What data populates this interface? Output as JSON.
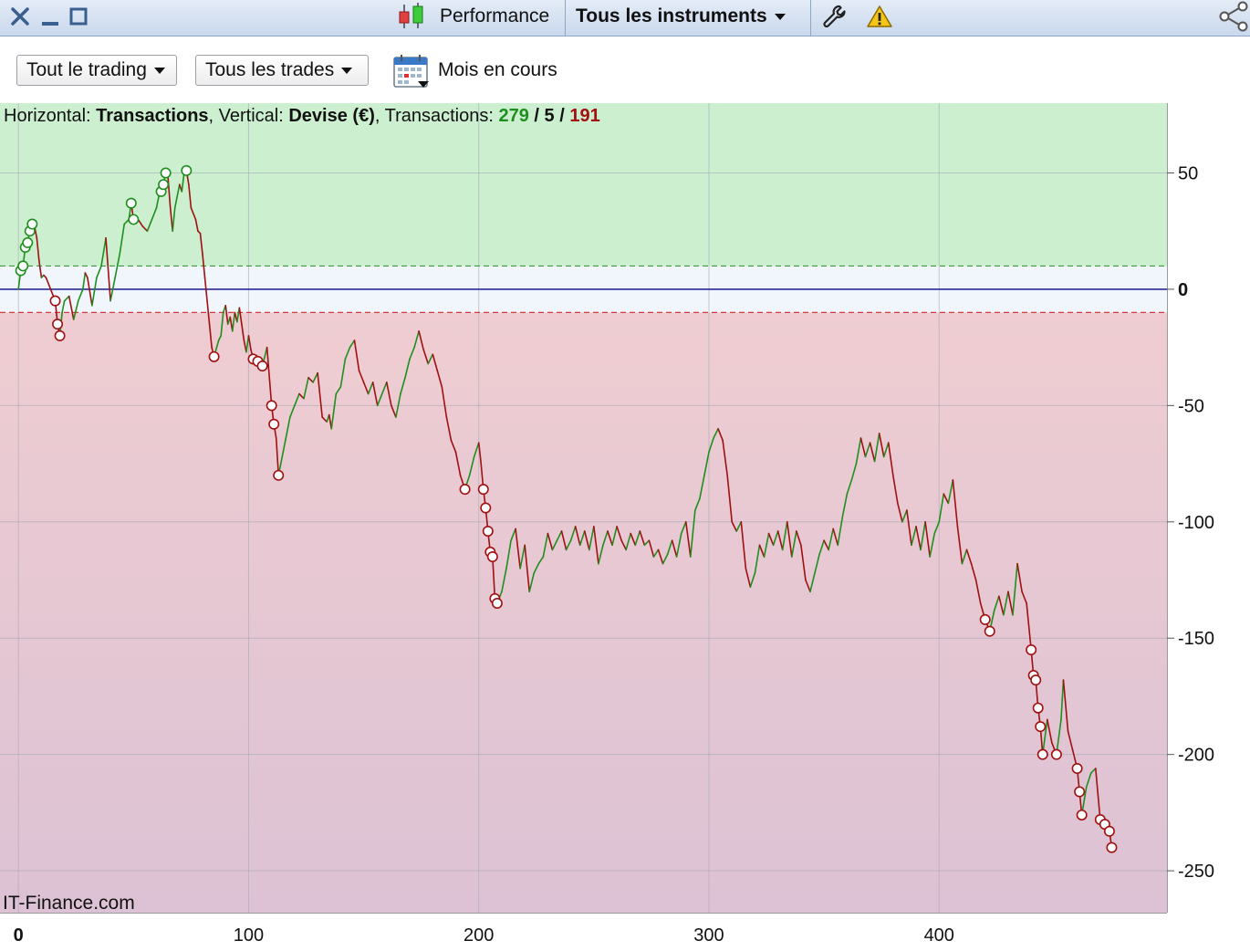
{
  "titlebar": {
    "performance_tab": "Performance",
    "instruments_menu": "Tous les instruments"
  },
  "toolbar": {
    "trading_filter": "Tout le trading",
    "trades_filter": "Tous les trades",
    "period_label": "Mois en cours"
  },
  "chart_header": {
    "h_label": "Horizontal: ",
    "h_value": "Transactions",
    "v_label": ", Vertical: ",
    "v_value": "Devise (€)",
    "t_label": ", Transactions: ",
    "winners": "279",
    "sep1": " / ",
    "neutral": "5",
    "sep2": " / ",
    "losers": "191"
  },
  "watermark": "IT-Finance.com",
  "colors": {
    "profit_zone": "#ccefd0",
    "loss_zone_top": "#efcdd2",
    "loss_zone_bottom": "#dcc2d4",
    "neutral_band": "#f1f5fc",
    "up_line": "#1e8f1e",
    "down_line": "#a01010",
    "zero_line": "#2a2a9a"
  },
  "chart_data": {
    "type": "line",
    "title": "",
    "xlabel": "Transactions",
    "ylabel": "Devise (€)",
    "xlim": [
      -8,
      499
    ],
    "ylim": [
      -268,
      80
    ],
    "x_ticks": [
      0,
      100,
      200,
      300,
      400
    ],
    "x_tick_labels": [
      "0",
      "100",
      "200",
      "300",
      "400"
    ],
    "y_ticks": [
      50,
      0,
      -50,
      -100,
      -150,
      -200,
      -250
    ],
    "y_tick_labels": [
      "50",
      "0",
      "-50",
      "-100",
      "-150",
      "-200",
      "-250"
    ],
    "profit_threshold": 10,
    "loss_threshold": -10,
    "grid": true,
    "series": [
      {
        "points": [
          [
            0,
            0
          ],
          [
            1,
            8
          ],
          [
            2,
            10
          ],
          [
            3,
            18
          ],
          [
            4,
            20
          ],
          [
            5,
            25
          ],
          [
            6,
            28
          ],
          [
            7,
            27
          ],
          [
            8,
            22
          ],
          [
            9,
            12
          ],
          [
            10,
            5
          ],
          [
            11,
            6
          ],
          [
            12,
            5
          ],
          [
            14,
            0
          ],
          [
            16,
            -5
          ],
          [
            17,
            -15
          ],
          [
            18,
            -20
          ],
          [
            19,
            -10
          ],
          [
            20,
            -5
          ],
          [
            22,
            -3
          ],
          [
            24,
            -13
          ],
          [
            26,
            -5
          ],
          [
            28,
            0
          ],
          [
            29,
            7
          ],
          [
            30,
            5
          ],
          [
            32,
            -7
          ],
          [
            34,
            5
          ],
          [
            36,
            10
          ],
          [
            38,
            22
          ],
          [
            40,
            -5
          ],
          [
            42,
            5
          ],
          [
            44,
            15
          ],
          [
            46,
            28
          ],
          [
            48,
            30
          ],
          [
            49,
            37
          ],
          [
            50,
            30
          ],
          [
            52,
            30
          ],
          [
            54,
            27
          ],
          [
            56,
            25
          ],
          [
            58,
            30
          ],
          [
            60,
            35
          ],
          [
            61,
            40
          ],
          [
            62,
            42
          ],
          [
            63,
            45
          ],
          [
            64,
            50
          ],
          [
            65,
            48
          ],
          [
            66,
            35
          ],
          [
            67,
            25
          ],
          [
            68,
            35
          ],
          [
            70,
            45
          ],
          [
            71,
            42
          ],
          [
            72,
            50
          ],
          [
            73,
            51
          ],
          [
            74,
            45
          ],
          [
            75,
            35
          ],
          [
            77,
            30
          ],
          [
            78,
            25
          ],
          [
            79,
            24
          ],
          [
            80,
            15
          ],
          [
            81,
            5
          ],
          [
            82,
            -5
          ],
          [
            83,
            -15
          ],
          [
            84,
            -25
          ],
          [
            85,
            -29
          ],
          [
            87,
            -22
          ],
          [
            88,
            -20
          ],
          [
            89,
            -10
          ],
          [
            90,
            -7
          ],
          [
            91,
            -15
          ],
          [
            92,
            -12
          ],
          [
            93,
            -18
          ],
          [
            94,
            -10
          ],
          [
            95,
            -14
          ],
          [
            96,
            -8
          ],
          [
            97,
            -15
          ],
          [
            98,
            -22
          ],
          [
            99,
            -27
          ],
          [
            100,
            -20
          ],
          [
            101,
            -26
          ],
          [
            102,
            -30
          ],
          [
            104,
            -31
          ],
          [
            106,
            -33
          ],
          [
            108,
            -25
          ],
          [
            110,
            -50
          ],
          [
            111,
            -58
          ],
          [
            112,
            -64
          ],
          [
            113,
            -80
          ],
          [
            114,
            -75
          ],
          [
            116,
            -65
          ],
          [
            118,
            -55
          ],
          [
            120,
            -50
          ],
          [
            122,
            -45
          ],
          [
            124,
            -47
          ],
          [
            126,
            -38
          ],
          [
            128,
            -40
          ],
          [
            130,
            -36
          ],
          [
            132,
            -55
          ],
          [
            134,
            -57
          ],
          [
            135,
            -54
          ],
          [
            136,
            -60
          ],
          [
            138,
            -45
          ],
          [
            140,
            -42
          ],
          [
            142,
            -30
          ],
          [
            144,
            -25
          ],
          [
            146,
            -22
          ],
          [
            148,
            -35
          ],
          [
            150,
            -40
          ],
          [
            152,
            -45
          ],
          [
            154,
            -40
          ],
          [
            156,
            -50
          ],
          [
            158,
            -45
          ],
          [
            160,
            -40
          ],
          [
            162,
            -50
          ],
          [
            164,
            -55
          ],
          [
            166,
            -45
          ],
          [
            168,
            -38
          ],
          [
            170,
            -30
          ],
          [
            172,
            -25
          ],
          [
            174,
            -18
          ],
          [
            176,
            -26
          ],
          [
            178,
            -32
          ],
          [
            180,
            -28
          ],
          [
            182,
            -35
          ],
          [
            184,
            -42
          ],
          [
            186,
            -55
          ],
          [
            188,
            -65
          ],
          [
            190,
            -70
          ],
          [
            192,
            -80
          ],
          [
            194,
            -86
          ],
          [
            196,
            -80
          ],
          [
            198,
            -72
          ],
          [
            200,
            -66
          ],
          [
            201,
            -75
          ],
          [
            202,
            -86
          ],
          [
            203,
            -94
          ],
          [
            204,
            -104
          ],
          [
            205,
            -113
          ],
          [
            206,
            -115
          ],
          [
            207,
            -133
          ],
          [
            208,
            -135
          ],
          [
            210,
            -130
          ],
          [
            212,
            -120
          ],
          [
            214,
            -108
          ],
          [
            216,
            -103
          ],
          [
            218,
            -120
          ],
          [
            220,
            -110
          ],
          [
            222,
            -130
          ],
          [
            224,
            -122
          ],
          [
            226,
            -118
          ],
          [
            228,
            -115
          ],
          [
            230,
            -105
          ],
          [
            232,
            -112
          ],
          [
            234,
            -108
          ],
          [
            236,
            -104
          ],
          [
            238,
            -112
          ],
          [
            240,
            -108
          ],
          [
            242,
            -102
          ],
          [
            244,
            -110
          ],
          [
            246,
            -104
          ],
          [
            248,
            -112
          ],
          [
            250,
            -102
          ],
          [
            252,
            -118
          ],
          [
            254,
            -110
          ],
          [
            256,
            -104
          ],
          [
            258,
            -110
          ],
          [
            260,
            -102
          ],
          [
            262,
            -108
          ],
          [
            264,
            -112
          ],
          [
            266,
            -105
          ],
          [
            268,
            -110
          ],
          [
            270,
            -104
          ],
          [
            272,
            -110
          ],
          [
            274,
            -108
          ],
          [
            276,
            -115
          ],
          [
            278,
            -112
          ],
          [
            280,
            -118
          ],
          [
            282,
            -114
          ],
          [
            284,
            -108
          ],
          [
            286,
            -115
          ],
          [
            288,
            -105
          ],
          [
            290,
            -100
          ],
          [
            292,
            -115
          ],
          [
            294,
            -95
          ],
          [
            296,
            -90
          ],
          [
            298,
            -80
          ],
          [
            300,
            -70
          ],
          [
            302,
            -64
          ],
          [
            304,
            -60
          ],
          [
            306,
            -65
          ],
          [
            308,
            -80
          ],
          [
            310,
            -100
          ],
          [
            312,
            -104
          ],
          [
            314,
            -100
          ],
          [
            316,
            -120
          ],
          [
            318,
            -128
          ],
          [
            320,
            -122
          ],
          [
            322,
            -110
          ],
          [
            324,
            -115
          ],
          [
            326,
            -105
          ],
          [
            328,
            -110
          ],
          [
            330,
            -104
          ],
          [
            332,
            -112
          ],
          [
            334,
            -100
          ],
          [
            336,
            -115
          ],
          [
            338,
            -104
          ],
          [
            340,
            -110
          ],
          [
            342,
            -125
          ],
          [
            344,
            -130
          ],
          [
            346,
            -122
          ],
          [
            348,
            -114
          ],
          [
            350,
            -108
          ],
          [
            352,
            -112
          ],
          [
            354,
            -103
          ],
          [
            356,
            -110
          ],
          [
            358,
            -98
          ],
          [
            360,
            -88
          ],
          [
            362,
            -82
          ],
          [
            364,
            -75
          ],
          [
            366,
            -64
          ],
          [
            368,
            -72
          ],
          [
            370,
            -66
          ],
          [
            372,
            -74
          ],
          [
            374,
            -62
          ],
          [
            376,
            -72
          ],
          [
            378,
            -66
          ],
          [
            380,
            -80
          ],
          [
            382,
            -92
          ],
          [
            384,
            -100
          ],
          [
            386,
            -95
          ],
          [
            388,
            -110
          ],
          [
            390,
            -102
          ],
          [
            392,
            -112
          ],
          [
            394,
            -100
          ],
          [
            396,
            -115
          ],
          [
            398,
            -105
          ],
          [
            400,
            -100
          ],
          [
            402,
            -88
          ],
          [
            404,
            -92
          ],
          [
            406,
            -82
          ],
          [
            408,
            -102
          ],
          [
            410,
            -118
          ],
          [
            412,
            -112
          ],
          [
            414,
            -118
          ],
          [
            416,
            -125
          ],
          [
            418,
            -135
          ],
          [
            420,
            -142
          ],
          [
            422,
            -147
          ],
          [
            424,
            -138
          ],
          [
            426,
            -132
          ],
          [
            428,
            -140
          ],
          [
            430,
            -130
          ],
          [
            432,
            -140
          ],
          [
            434,
            -118
          ],
          [
            436,
            -130
          ],
          [
            438,
            -135
          ],
          [
            440,
            -155
          ],
          [
            441,
            -166
          ],
          [
            442,
            -168
          ],
          [
            443,
            -180
          ],
          [
            444,
            -188
          ],
          [
            445,
            -200
          ],
          [
            447,
            -185
          ],
          [
            449,
            -195
          ],
          [
            451,
            -200
          ],
          [
            453,
            -185
          ],
          [
            454,
            -168
          ],
          [
            456,
            -190
          ],
          [
            458,
            -198
          ],
          [
            460,
            -206
          ],
          [
            461,
            -216
          ],
          [
            462,
            -226
          ],
          [
            464,
            -214
          ],
          [
            466,
            -208
          ],
          [
            468,
            -206
          ],
          [
            470,
            -228
          ],
          [
            472,
            -230
          ],
          [
            474,
            -233
          ],
          [
            475,
            -240
          ]
        ]
      }
    ],
    "markers": [
      [
        1,
        8
      ],
      [
        2,
        10
      ],
      [
        3,
        18
      ],
      [
        4,
        20
      ],
      [
        5,
        25
      ],
      [
        6,
        28
      ],
      [
        16,
        -5
      ],
      [
        17,
        -15
      ],
      [
        18,
        -20
      ],
      [
        49,
        37
      ],
      [
        50,
        30
      ],
      [
        62,
        42
      ],
      [
        63,
        45
      ],
      [
        64,
        50
      ],
      [
        73,
        51
      ],
      [
        85,
        -29
      ],
      [
        102,
        -30
      ],
      [
        104,
        -31
      ],
      [
        106,
        -33
      ],
      [
        110,
        -50
      ],
      [
        111,
        -58
      ],
      [
        113,
        -80
      ],
      [
        194,
        -86
      ],
      [
        202,
        -86
      ],
      [
        203,
        -94
      ],
      [
        204,
        -104
      ],
      [
        205,
        -113
      ],
      [
        206,
        -115
      ],
      [
        207,
        -133
      ],
      [
        208,
        -135
      ],
      [
        420,
        -142
      ],
      [
        422,
        -147
      ],
      [
        440,
        -155
      ],
      [
        441,
        -166
      ],
      [
        442,
        -168
      ],
      [
        443,
        -180
      ],
      [
        444,
        -188
      ],
      [
        445,
        -200
      ],
      [
        451,
        -200
      ],
      [
        460,
        -206
      ],
      [
        461,
        -216
      ],
      [
        462,
        -226
      ],
      [
        470,
        -228
      ],
      [
        472,
        -230
      ],
      [
        474,
        -233
      ],
      [
        475,
        -240
      ]
    ]
  }
}
